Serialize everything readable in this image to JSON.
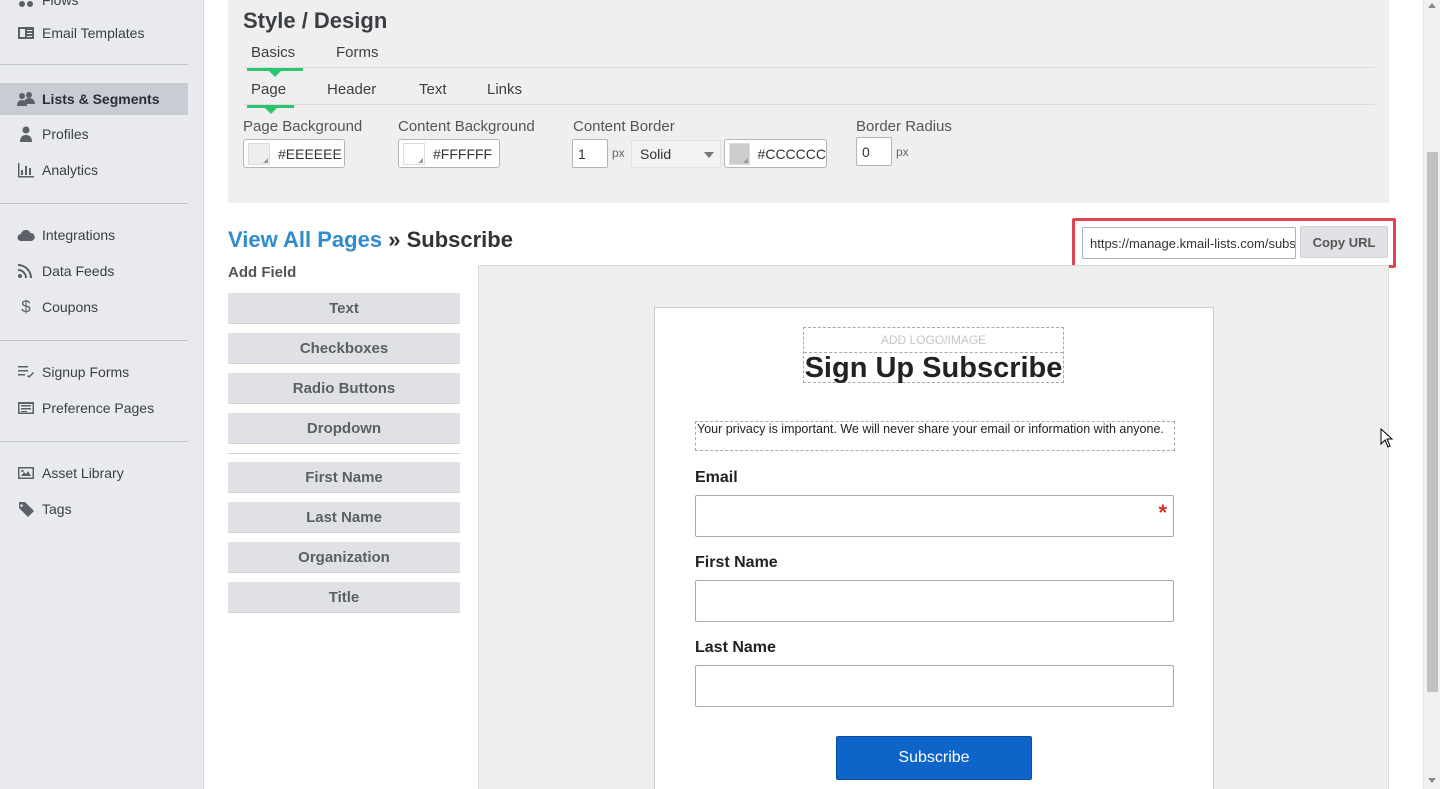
{
  "sidebar": {
    "items": [
      {
        "label": "Flows",
        "icon": "flows-icon"
      },
      {
        "label": "Email Templates",
        "icon": "email-templates-icon"
      },
      {
        "label": "Lists & Segments",
        "icon": "users-icon",
        "active": true
      },
      {
        "label": "Profiles",
        "icon": "profile-icon"
      },
      {
        "label": "Analytics",
        "icon": "bar-chart-icon"
      },
      {
        "label": "Integrations",
        "icon": "cloud-icon"
      },
      {
        "label": "Data Feeds",
        "icon": "rss-icon"
      },
      {
        "label": "Coupons",
        "icon": "dollar-icon"
      },
      {
        "label": "Signup Forms",
        "icon": "list-icon"
      },
      {
        "label": "Preference Pages",
        "icon": "preference-page-icon"
      },
      {
        "label": "Asset Library",
        "icon": "image-icon"
      },
      {
        "label": "Tags",
        "icon": "tag-icon"
      }
    ]
  },
  "style": {
    "title": "Style / Design",
    "tabs_main": [
      {
        "label": "Basics",
        "active": true
      },
      {
        "label": "Forms",
        "active": false
      }
    ],
    "tabs_sub": [
      {
        "label": "Page",
        "active": true
      },
      {
        "label": "Header",
        "active": false
      },
      {
        "label": "Text",
        "active": false
      },
      {
        "label": "Links",
        "active": false
      }
    ],
    "page_background": {
      "label": "Page Background",
      "value": "#EEEEEE"
    },
    "content_background": {
      "label": "Content Background",
      "value": "#FFFFFF"
    },
    "content_border": {
      "label": "Content Border",
      "width": "1",
      "unit": "px",
      "style": "Solid",
      "color": "#CCCCCC"
    },
    "border_radius": {
      "label": "Border Radius",
      "value": "0",
      "unit": "px"
    }
  },
  "breadcrumb": {
    "link": "View All Pages",
    "separator": "»",
    "current": "Subscribe"
  },
  "url": {
    "value": "https://manage.kmail-lists.com/subscriptions/subscribe",
    "copy_label": "Copy URL"
  },
  "add_field": {
    "title": "Add Field",
    "basic_buttons": [
      "Text",
      "Checkboxes",
      "Radio Buttons",
      "Dropdown"
    ],
    "profile_buttons": [
      "First Name",
      "Last Name",
      "Organization",
      "Title"
    ]
  },
  "form": {
    "logo_placeholder": "ADD LOGO/IMAGE",
    "title": "Sign Up Subscribe",
    "privacy": "Your privacy is important. We will never share your email or information with anyone.",
    "fields": [
      {
        "label": "Email",
        "required": true,
        "required_mark": "*"
      },
      {
        "label": "First Name",
        "required": false
      },
      {
        "label": "Last Name",
        "required": false
      }
    ],
    "submit_label": "Subscribe"
  },
  "colors": {
    "accent_green": "#2cc56f",
    "link_blue": "#2e8ccf",
    "submit_blue": "#0e64c8",
    "highlight_red": "#e0454f"
  }
}
